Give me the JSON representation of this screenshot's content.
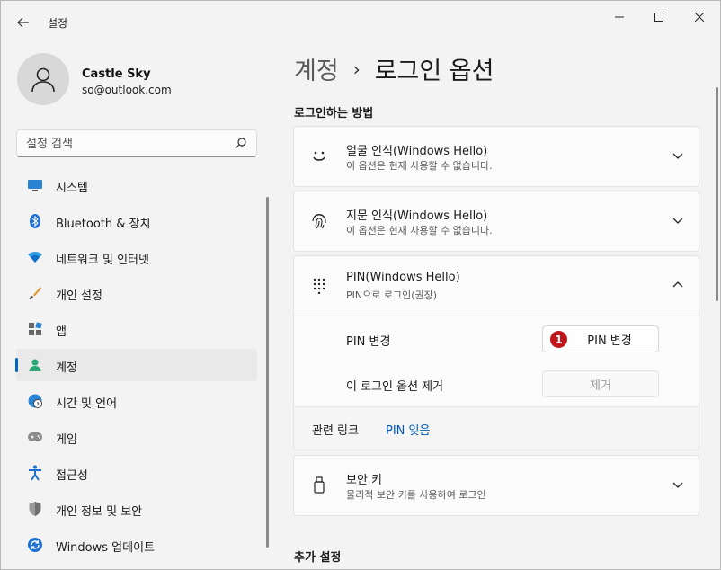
{
  "window": {
    "title": "설정"
  },
  "profile": {
    "name": "Castle Sky",
    "email": "so@outlook.com"
  },
  "search": {
    "placeholder": "설정 검색"
  },
  "nav": {
    "items": [
      {
        "label": "시스템",
        "icon": "system-icon"
      },
      {
        "label": "Bluetooth & 장치",
        "icon": "bluetooth-icon"
      },
      {
        "label": "네트워크 및 인터넷",
        "icon": "wifi-icon"
      },
      {
        "label": "개인 설정",
        "icon": "brush-icon"
      },
      {
        "label": "앱",
        "icon": "apps-icon"
      },
      {
        "label": "계정",
        "icon": "account-icon",
        "active": true
      },
      {
        "label": "시간 및 언어",
        "icon": "globe-clock-icon"
      },
      {
        "label": "게임",
        "icon": "gamepad-icon"
      },
      {
        "label": "접근성",
        "icon": "accessibility-icon"
      },
      {
        "label": "개인 정보 및 보안",
        "icon": "shield-icon"
      },
      {
        "label": "Windows 업데이트",
        "icon": "update-icon"
      }
    ]
  },
  "breadcrumb": {
    "parent": "계정",
    "separator": "›",
    "current": "로그인 옵션"
  },
  "sections": {
    "sign_in_ways": "로그인하는 방법",
    "additional": "추가 설정"
  },
  "cards": {
    "face": {
      "title": "얼굴 인식(Windows Hello)",
      "subtitle": "이 옵션은 현재 사용할 수 없습니다."
    },
    "fingerprint": {
      "title": "지문 인식(Windows Hello)",
      "subtitle": "이 옵션은 현재 사용할 수 없습니다."
    },
    "pin": {
      "title": "PIN(Windows Hello)",
      "subtitle": "PIN으로 로그인(권장)",
      "change_label": "PIN 변경",
      "change_button": "PIN 변경",
      "badge": "1",
      "remove_label": "이 로그인 옵션 제거",
      "remove_button": "제거",
      "related_label": "관련 링크",
      "related_link": "PIN 잊음"
    },
    "security_key": {
      "title": "보안 키",
      "subtitle": "물리적 보안 키를 사용하여 로그인"
    }
  },
  "colors": {
    "accent": "#0067c0",
    "badge": "#c0161c",
    "link": "#0059b5"
  }
}
